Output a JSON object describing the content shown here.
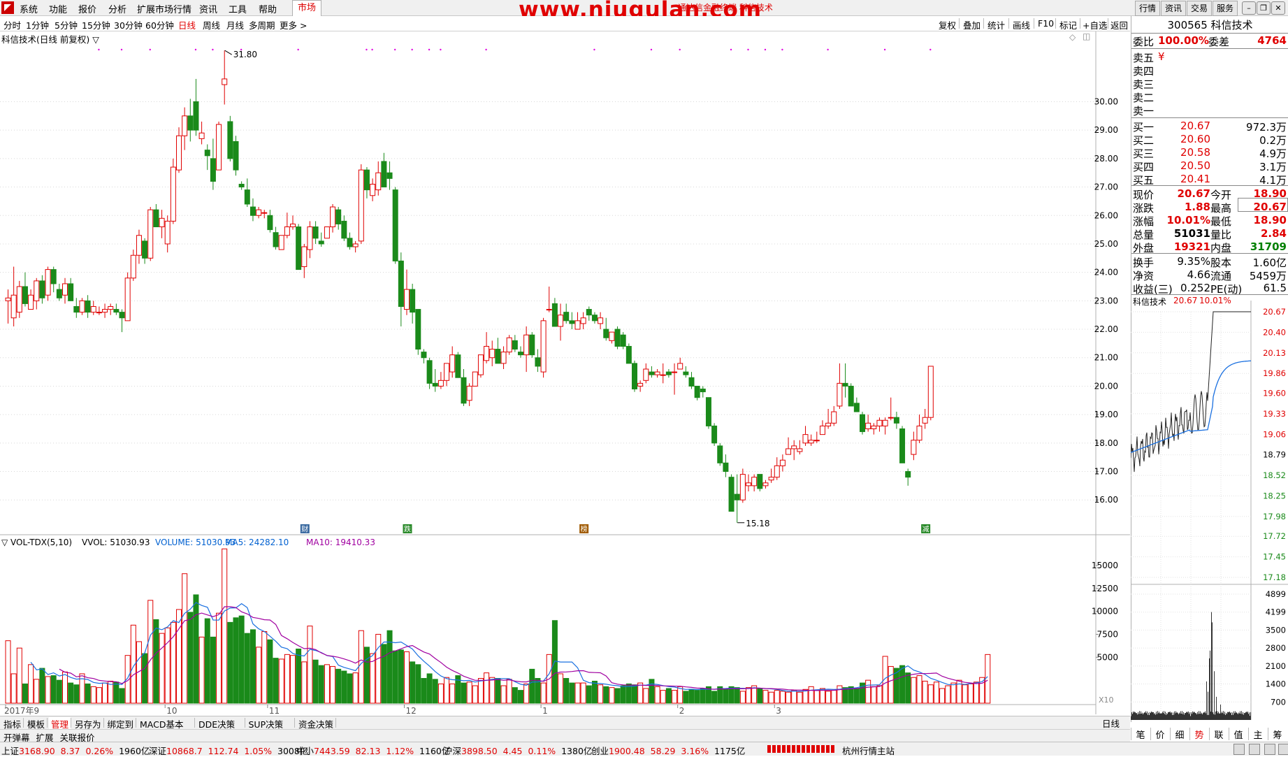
{
  "menubar": {
    "items": [
      "系统",
      "功能",
      "报价",
      "分析",
      "扩展市场行情",
      "资讯",
      "工具",
      "帮助"
    ],
    "market_tab": "市场",
    "watermark": "www.niugulan.com",
    "title_small": "通达信金融终端 科信技术",
    "right_buttons": [
      "行情",
      "资讯",
      "交易",
      "服务"
    ]
  },
  "periodbar": {
    "periods": [
      "分时",
      "1分钟",
      "5分钟",
      "15分钟",
      "30分钟",
      "60分钟",
      "日线",
      "周线",
      "月线",
      "多周期",
      "更多 >"
    ],
    "active": "日线",
    "tools": [
      "复权",
      "叠加",
      "统计",
      "画线",
      "F10",
      "标记",
      "+自选",
      "返回"
    ]
  },
  "kline": {
    "header": "科信技术(日线 前复权) ▽",
    "high_label": "31.80",
    "low_label": "15.18",
    "y_ticks": [
      "30.00",
      "29.00",
      "28.00",
      "27.00",
      "26.00",
      "25.00",
      "24.00",
      "23.00",
      "22.00",
      "21.00",
      "20.00",
      "19.00",
      "18.00",
      "17.00",
      "16.00"
    ],
    "event_markers": [
      "财",
      "跌",
      "榜",
      "减"
    ],
    "candles": [
      [
        23.0,
        23.4,
        22.2,
        23.1
      ],
      [
        22.4,
        24.2,
        22.1,
        23.2
      ],
      [
        22.6,
        23.7,
        22.4,
        23.5
      ],
      [
        23.5,
        24.0,
        22.8,
        22.9
      ],
      [
        22.7,
        23.4,
        22.7,
        23.2
      ],
      [
        23.0,
        23.8,
        22.7,
        23.7
      ],
      [
        23.7,
        23.9,
        22.9,
        23.1
      ],
      [
        23.2,
        24.2,
        23.0,
        24.1
      ],
      [
        24.1,
        24.2,
        23.3,
        23.6
      ],
      [
        23.4,
        23.6,
        23.0,
        23.1
      ],
      [
        23.2,
        23.8,
        22.9,
        23.6
      ],
      [
        23.6,
        23.8,
        23.0,
        23.0
      ],
      [
        22.8,
        23.1,
        22.4,
        22.6
      ],
      [
        22.6,
        23.1,
        22.5,
        23.0
      ],
      [
        23.0,
        23.2,
        22.4,
        22.6
      ],
      [
        22.6,
        23.0,
        22.5,
        22.8
      ],
      [
        22.6,
        22.8,
        22.5,
        22.6
      ],
      [
        22.6,
        22.9,
        22.4,
        22.7
      ],
      [
        22.7,
        22.9,
        22.5,
        22.8
      ],
      [
        22.7,
        22.9,
        22.5,
        22.6
      ],
      [
        22.6,
        22.7,
        21.9,
        22.4
      ],
      [
        22.3,
        24.0,
        22.3,
        23.8
      ],
      [
        23.8,
        24.8,
        23.7,
        24.6
      ],
      [
        24.6,
        25.5,
        24.3,
        25.3
      ],
      [
        25.1,
        25.2,
        24.3,
        24.5
      ],
      [
        24.5,
        26.3,
        24.4,
        26.2
      ],
      [
        26.2,
        26.4,
        25.6,
        25.6
      ],
      [
        25.6,
        26.2,
        25.2,
        25.9
      ],
      [
        25.0,
        26.0,
        24.7,
        25.8
      ],
      [
        25.8,
        28.0,
        25.7,
        27.7
      ],
      [
        27.6,
        29.1,
        27.5,
        28.8
      ],
      [
        28.8,
        29.8,
        28.3,
        29.5
      ],
      [
        29.5,
        30.1,
        28.6,
        29.0
      ],
      [
        30.0,
        30.8,
        28.8,
        29.0
      ],
      [
        28.7,
        29.3,
        28.5,
        28.9
      ],
      [
        28.3,
        28.5,
        27.6,
        28.1
      ],
      [
        28.0,
        28.7,
        26.9,
        27.2
      ],
      [
        27.6,
        29.3,
        27.6,
        29.2
      ],
      [
        30.6,
        31.8,
        29.9,
        30.8
      ],
      [
        29.3,
        29.5,
        27.9,
        28.0
      ],
      [
        28.6,
        28.8,
        27.4,
        27.6
      ],
      [
        27.1,
        27.2,
        26.9,
        27.0
      ],
      [
        26.9,
        27.3,
        26.3,
        26.4
      ],
      [
        26.3,
        26.6,
        25.8,
        26.0
      ],
      [
        26.0,
        26.3,
        25.9,
        26.2
      ],
      [
        26.1,
        26.2,
        25.9,
        26.1
      ],
      [
        26.0,
        26.2,
        25.4,
        25.5
      ],
      [
        25.4,
        25.6,
        24.8,
        24.9
      ],
      [
        24.8,
        25.3,
        24.8,
        25.3
      ],
      [
        25.3,
        26.1,
        25.2,
        25.6
      ],
      [
        25.6,
        26.0,
        25.5,
        25.7
      ],
      [
        25.6,
        25.7,
        24.1,
        24.1
      ],
      [
        24.2,
        25.0,
        23.8,
        24.9
      ],
      [
        24.8,
        25.8,
        24.5,
        25.6
      ],
      [
        25.6,
        25.8,
        25.0,
        25.2
      ],
      [
        25.1,
        25.4,
        24.9,
        25.0
      ],
      [
        25.2,
        25.6,
        25.2,
        25.6
      ],
      [
        25.6,
        26.4,
        25.4,
        26.3
      ],
      [
        26.2,
        26.3,
        25.5,
        25.7
      ],
      [
        25.8,
        26.0,
        25.1,
        25.2
      ],
      [
        25.2,
        25.4,
        24.8,
        24.9
      ],
      [
        24.9,
        25.1,
        24.7,
        25.0
      ],
      [
        25.1,
        27.8,
        25.0,
        27.6
      ],
      [
        27.6,
        27.7,
        26.6,
        26.9
      ],
      [
        26.7,
        27.3,
        26.5,
        27.1
      ],
      [
        26.9,
        27.9,
        26.7,
        27.5
      ],
      [
        27.9,
        28.2,
        27.0,
        27.0
      ],
      [
        27.5,
        27.9,
        26.9,
        27.3
      ],
      [
        26.9,
        27.0,
        24.3,
        24.4
      ],
      [
        24.4,
        24.7,
        22.1,
        22.8
      ],
      [
        22.7,
        24.1,
        22.5,
        23.4
      ],
      [
        23.4,
        23.6,
        22.2,
        22.6
      ],
      [
        22.7,
        22.7,
        21.1,
        21.3
      ],
      [
        21.2,
        21.3,
        20.8,
        21.0
      ],
      [
        20.9,
        21.0,
        19.9,
        20.1
      ],
      [
        20.1,
        20.6,
        19.8,
        20.0
      ],
      [
        20.0,
        20.5,
        19.9,
        20.2
      ],
      [
        20.2,
        20.8,
        20.0,
        20.8
      ],
      [
        20.5,
        21.4,
        20.3,
        21.1
      ],
      [
        21.1,
        21.2,
        20.3,
        20.3
      ],
      [
        20.3,
        20.6,
        19.3,
        19.4
      ],
      [
        19.5,
        20.1,
        19.3,
        20.0
      ],
      [
        20.0,
        20.5,
        20.0,
        20.5
      ],
      [
        20.4,
        21.1,
        20.3,
        21.1
      ],
      [
        20.9,
        21.9,
        20.8,
        21.4
      ],
      [
        21.0,
        21.6,
        20.7,
        21.3
      ],
      [
        21.3,
        21.7,
        20.8,
        20.8
      ],
      [
        20.8,
        21.4,
        20.6,
        21.2
      ],
      [
        21.2,
        21.8,
        21.1,
        21.7
      ],
      [
        21.6,
        21.8,
        21.2,
        21.3
      ],
      [
        21.2,
        21.4,
        21.0,
        21.1
      ],
      [
        21.1,
        22.1,
        20.5,
        21.8
      ],
      [
        21.8,
        21.9,
        21.0,
        21.1
      ],
      [
        21.0,
        21.3,
        20.5,
        20.7
      ],
      [
        20.5,
        22.4,
        20.3,
        22.3
      ],
      [
        22.7,
        23.5,
        22.6,
        22.7
      ],
      [
        22.9,
        23.1,
        22.3,
        22.1
      ],
      [
        22.1,
        22.9,
        21.6,
        22.5
      ],
      [
        22.6,
        22.9,
        22.2,
        22.3
      ],
      [
        22.3,
        22.6,
        22.0,
        22.2
      ],
      [
        22.0,
        22.6,
        22.0,
        22.3
      ],
      [
        22.2,
        22.6,
        22.0,
        22.4
      ],
      [
        22.7,
        22.8,
        22.3,
        22.5
      ],
      [
        22.5,
        22.6,
        22.2,
        22.3
      ],
      [
        22.2,
        22.6,
        22.0,
        22.4
      ],
      [
        22.0,
        22.4,
        21.6,
        21.7
      ],
      [
        21.6,
        21.7,
        21.5,
        21.9
      ],
      [
        22.0,
        22.1,
        21.3,
        21.4
      ],
      [
        21.8,
        21.9,
        21.3,
        21.4
      ],
      [
        21.4,
        21.5,
        20.8,
        20.8
      ],
      [
        20.8,
        20.9,
        19.8,
        19.9
      ],
      [
        20.0,
        20.2,
        19.8,
        20.1
      ],
      [
        20.2,
        20.8,
        20.1,
        20.6
      ],
      [
        20.5,
        20.7,
        20.3,
        20.4
      ],
      [
        20.4,
        20.6,
        20.3,
        20.5
      ],
      [
        20.4,
        20.8,
        20.1,
        20.4
      ],
      [
        20.5,
        20.6,
        20.3,
        20.4
      ],
      [
        20.5,
        20.8,
        19.7,
        20.5
      ],
      [
        20.6,
        21.0,
        20.6,
        20.8
      ],
      [
        20.5,
        20.7,
        20.3,
        20.4
      ],
      [
        20.3,
        20.5,
        19.9,
        20.0
      ],
      [
        20.0,
        20.0,
        19.5,
        19.6
      ],
      [
        19.9,
        20.0,
        19.6,
        19.8
      ],
      [
        19.6,
        19.6,
        18.5,
        18.6
      ],
      [
        18.6,
        18.7,
        17.9,
        18.0
      ],
      [
        17.9,
        18.0,
        17.2,
        17.3
      ],
      [
        17.3,
        17.6,
        16.8,
        17.0
      ],
      [
        16.8,
        16.9,
        15.9,
        15.6
      ],
      [
        16.2,
        16.9,
        15.2,
        16.0
      ],
      [
        16.0,
        17.1,
        15.9,
        16.9
      ],
      [
        16.5,
        16.9,
        16.3,
        16.6
      ],
      [
        16.5,
        16.9,
        16.3,
        16.8
      ],
      [
        16.9,
        16.9,
        16.3,
        16.4
      ],
      [
        16.5,
        16.7,
        16.4,
        16.6
      ],
      [
        16.7,
        17.1,
        16.6,
        16.8
      ],
      [
        16.8,
        17.5,
        16.7,
        17.2
      ],
      [
        17.2,
        17.6,
        17.0,
        17.4
      ],
      [
        17.6,
        18.2,
        17.6,
        17.8
      ],
      [
        17.8,
        18.1,
        17.4,
        17.9
      ],
      [
        17.7,
        18.1,
        17.6,
        17.8
      ],
      [
        18.0,
        18.6,
        17.9,
        18.3
      ],
      [
        18.0,
        18.3,
        17.9,
        18.1
      ],
      [
        18.1,
        18.4,
        18.0,
        18.1
      ],
      [
        18.3,
        18.8,
        18.3,
        18.6
      ],
      [
        18.6,
        19.2,
        18.5,
        18.7
      ],
      [
        18.7,
        19.3,
        18.6,
        19.1
      ],
      [
        19.3,
        20.8,
        19.2,
        20.1
      ],
      [
        20.1,
        20.8,
        19.6,
        20.0
      ],
      [
        20.0,
        20.1,
        19.3,
        19.3
      ],
      [
        19.4,
        19.6,
        19.1,
        19.1
      ],
      [
        19.0,
        19.1,
        18.3,
        18.4
      ],
      [
        18.5,
        19.0,
        18.4,
        18.7
      ],
      [
        18.5,
        18.7,
        18.3,
        18.6
      ],
      [
        18.6,
        18.9,
        18.4,
        18.8
      ],
      [
        18.6,
        18.9,
        18.3,
        18.8
      ],
      [
        18.9,
        19.6,
        18.8,
        18.9
      ],
      [
        18.9,
        19.1,
        18.5,
        18.7
      ],
      [
        18.5,
        18.6,
        17.4,
        17.3
      ],
      [
        17.0,
        17.1,
        16.5,
        16.8
      ],
      [
        17.6,
        18.4,
        17.4,
        18.1
      ],
      [
        18.1,
        19.0,
        18.0,
        18.6
      ],
      [
        18.7,
        19.2,
        18.5,
        18.9
      ],
      [
        18.9,
        20.7,
        18.8,
        20.7
      ]
    ]
  },
  "volume": {
    "header": "▽ VOL-TDX(5,10)",
    "vvol": "VVOL: 51030.93",
    "volume_label": "VOLUME: 51030.93",
    "ma5_label": "MA5: 24282.10",
    "ma10_label": "MA10: 19410.33",
    "y_ticks": [
      "15000",
      "12500",
      "10000",
      "7500",
      "5000"
    ],
    "unit": "X10",
    "month_labels": [
      "2017年9",
      "10",
      "11",
      "12",
      "1",
      "2",
      "3"
    ],
    "values": [
      6800,
      3200,
      6000,
      2100,
      4200,
      2600,
      3800,
      2900,
      3000,
      2500,
      3400,
      2200,
      2000,
      3200,
      2100,
      1800,
      1700,
      2200,
      2400,
      2300,
      1600,
      5200,
      8500,
      6700,
      5400,
      11200,
      9100,
      7600,
      8200,
      8800,
      10200,
      14100,
      9900,
      11800,
      7200,
      9200,
      7200,
      9800,
      16800,
      8800,
      9300,
      9500,
      7600,
      8000,
      6100,
      7800,
      6900,
      4900,
      4800,
      5300,
      5200,
      5900,
      4500,
      8400,
      4700,
      4100,
      4200,
      4000,
      3700,
      3500,
      3200,
      3300,
      7900,
      6100,
      5400,
      7500,
      6400,
      7900,
      5700,
      5800,
      5600,
      4500,
      4200,
      2700,
      3200,
      2600,
      2100,
      2800,
      2100,
      3000,
      2200,
      2300,
      1900,
      2700,
      3300,
      2800,
      2700,
      1900,
      2600,
      1700,
      1400,
      2100,
      3700,
      2700,
      2200,
      5300,
      9000,
      3200,
      2700,
      2200,
      2200,
      2200,
      1900,
      2400,
      2000,
      1800,
      1700,
      1600,
      1900,
      2100,
      2000,
      2200,
      1600,
      2600,
      1800,
      1400,
      1600,
      1400,
      1800,
      1300,
      1500,
      1400,
      1600,
      1800,
      1300,
      1800,
      1500,
      1800,
      1700,
      1300,
      1700,
      1900,
      1600,
      1400,
      1200,
      1400,
      1300,
      1200,
      1400,
      1200,
      1500,
      1800,
      1400,
      1600,
      1300,
      1400,
      1900,
      1700,
      1800,
      1600,
      2200,
      2500,
      1800,
      1900,
      5100,
      4000,
      3800,
      4100,
      3300,
      2800,
      3000,
      2400,
      2000,
      2300,
      1600,
      1900,
      2200,
      2500,
      2000,
      2100,
      2300,
      2800,
      5300
    ]
  },
  "intraday": {
    "title": "科信技术",
    "price": "20.67",
    "pct": "10.01%",
    "price_ticks": [
      "20.67",
      "20.40",
      "20.13",
      "19.86",
      "19.60",
      "19.33",
      "19.06",
      "18.79",
      "18.52",
      "18.25",
      "17.98",
      "17.72",
      "17.45",
      "17.18"
    ],
    "vol_ticks": [
      "4899",
      "4199",
      "3500",
      "2800",
      "2100",
      "1400",
      "700"
    ]
  },
  "quote": {
    "code_name": "300565 科信技术",
    "weibi_label": "委比",
    "weibi_value": "100.00%",
    "weicha_label": "委差",
    "weicha_value": "4764",
    "sells": [
      {
        "label": "卖五",
        "price": "¥",
        "vol": ""
      },
      {
        "label": "卖四",
        "price": "",
        "vol": ""
      },
      {
        "label": "卖三",
        "price": "",
        "vol": ""
      },
      {
        "label": "卖二",
        "price": "",
        "vol": ""
      },
      {
        "label": "卖一",
        "price": "",
        "vol": ""
      }
    ],
    "buys": [
      {
        "label": "买一",
        "price": "20.67",
        "vol": "972.3万"
      },
      {
        "label": "买二",
        "price": "20.60",
        "vol": "0.2万"
      },
      {
        "label": "买三",
        "price": "20.58",
        "vol": "4.9万"
      },
      {
        "label": "买四",
        "price": "20.50",
        "vol": "3.1万"
      },
      {
        "label": "买五",
        "price": "20.41",
        "vol": "4.1万"
      }
    ],
    "stats1": [
      {
        "k1": "现价",
        "v1": "20.67",
        "k2": "今开",
        "v2": "18.90",
        "c1": "red",
        "c2": "red"
      },
      {
        "k1": "涨跌",
        "v1": "1.88",
        "k2": "最高",
        "v2": "20.67",
        "c1": "red",
        "c2": "red"
      },
      {
        "k1": "涨幅",
        "v1": "10.01%",
        "k2": "最低",
        "v2": "18.90",
        "c1": "red",
        "c2": "red"
      },
      {
        "k1": "总量",
        "v1": "51031",
        "k2": "量比",
        "v2": "2.84",
        "c1": "black",
        "c2": "red"
      },
      {
        "k1": "外盘",
        "v1": "19321",
        "k2": "内盘",
        "v2": "31709",
        "c1": "red",
        "c2": "green"
      }
    ],
    "stats2": [
      {
        "k1": "换手",
        "v1": "9.35%",
        "k2": "股本",
        "v2": "1.60亿"
      },
      {
        "k1": "净资",
        "v1": "4.66",
        "k2": "流通",
        "v2": "5459万"
      },
      {
        "k1": "收益(三)",
        "v1": "0.252",
        "k2": "PE(动)",
        "v2": "61.5"
      }
    ]
  },
  "tabs1": [
    "指标",
    "模板",
    "管理",
    "另存为",
    "绑定到",
    "MACD基本",
    "DDE决策",
    "SUP决策",
    "资金决策"
  ],
  "tabs1_active": "管理",
  "tabs2": [
    "开弹幕",
    "扩展",
    "关联报价"
  ],
  "rp_tabs": [
    "笔",
    "价",
    "细",
    "势",
    "联",
    "值",
    "主",
    "筹"
  ],
  "rp_tabs_active": "势",
  "period_label": "日线",
  "status": [
    {
      "name": "上证",
      "value": "3168.90",
      "chg": "8.37",
      "pct": "0.26%",
      "amt": "1960亿"
    },
    {
      "name": "深证",
      "value": "10868.7",
      "chg": "112.74",
      "pct": "1.05%",
      "amt": "3008亿"
    },
    {
      "name": "中小",
      "value": "7443.59",
      "chg": "82.13",
      "pct": "1.12%",
      "amt": "1160亿"
    },
    {
      "name": "沪深",
      "value": "3898.50",
      "chg": "4.45",
      "pct": "0.11%",
      "amt": "1380亿"
    },
    {
      "name": "创业",
      "value": "1900.48",
      "chg": "58.29",
      "pct": "3.16%",
      "amt": "1175亿"
    }
  ],
  "station": "杭州行情主站"
}
